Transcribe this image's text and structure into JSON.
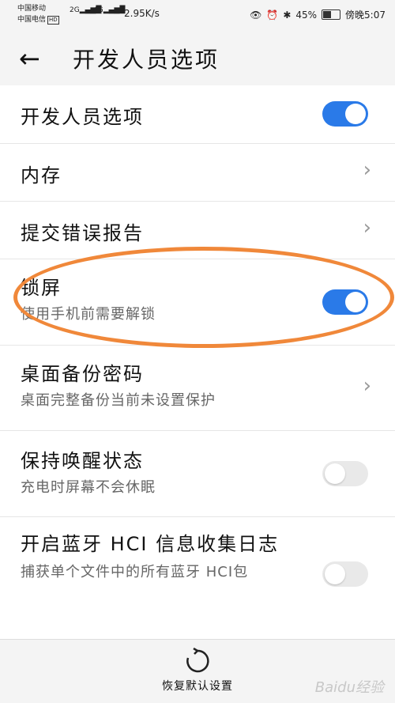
{
  "status_bar": {
    "carrier1": "中国移动",
    "carrier2": "中国电信",
    "hd": "HD",
    "sig1": "2G",
    "sig2": "4G",
    "speed": "2.95K/s",
    "battery_percent": "45%",
    "time": "傍晚5:07"
  },
  "header": {
    "title": "开发人员选项"
  },
  "rows": [
    {
      "title": "开发人员选项",
      "type": "toggle",
      "on": true
    },
    {
      "title": "内存",
      "type": "chevron"
    },
    {
      "title": "提交错误报告",
      "type": "chevron"
    },
    {
      "title": "锁屏",
      "subtitle": "使用手机前需要解锁",
      "type": "toggle",
      "on": true
    },
    {
      "title": "桌面备份密码",
      "subtitle": "桌面完整备份当前未设置保护",
      "type": "chevron"
    },
    {
      "title": "保持唤醒状态",
      "subtitle": "充电时屏幕不会休眠",
      "type": "toggle",
      "on": false
    },
    {
      "title": "开启蓝牙 HCI 信息收集日志",
      "subtitle": "捕获单个文件中的所有蓝牙 HCI包",
      "type": "toggle",
      "on": false
    }
  ],
  "bottom": {
    "restore_label": "恢复默认设置"
  },
  "watermark": "Baidu经验",
  "colors": {
    "accent": "#2a7ae8",
    "highlight_oval": "#f0883a"
  }
}
